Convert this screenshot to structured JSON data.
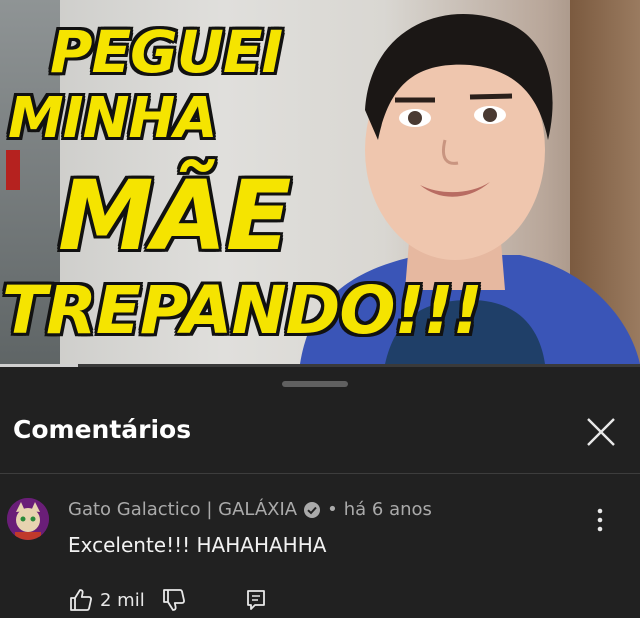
{
  "thumbnail": {
    "line1": "PEGUEI",
    "line2": "MINHA",
    "line3": "MÃE",
    "line4": "TREPANDO!!!"
  },
  "comments_panel": {
    "title": "Comentários",
    "close_icon": "close-icon"
  },
  "comment": {
    "author": "Gato Galactico | GALÁXIA",
    "verified_icon": "verified-check-icon",
    "separator": "•",
    "time": "há 6 anos",
    "text": "Excelente!!! HAHAHAHHA",
    "likes": "2 mil",
    "like_icon": "thumbs-up-icon",
    "dislike_icon": "thumbs-down-icon",
    "reply_icon": "reply-icon",
    "menu_icon": "more-vert-icon"
  },
  "colors": {
    "background": "#212121",
    "thumbnail_text": "#f5e400",
    "secondary_text": "#aaaaaa"
  }
}
